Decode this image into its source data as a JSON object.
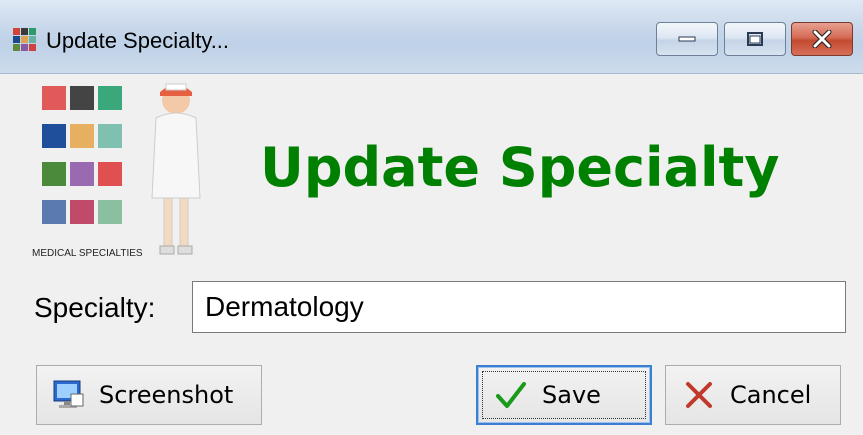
{
  "window": {
    "title": "Update Specialty...",
    "minimize_icon": "minimize-icon",
    "maximize_icon": "maximize-icon",
    "close_icon": "close-icon"
  },
  "logo": {
    "caption": "MEDICAL SPECIALTIES",
    "icon": "medical-specialties-logo"
  },
  "heading": "Update Specialty",
  "form": {
    "specialty_label": "Specialty:",
    "specialty_value": "Dermatology"
  },
  "buttons": {
    "screenshot_label": "Screenshot",
    "save_label": "Save",
    "cancel_label": "Cancel"
  },
  "colors": {
    "heading": "#008000",
    "save_check": "#1a9a1a",
    "cancel_x": "#c0392b"
  }
}
